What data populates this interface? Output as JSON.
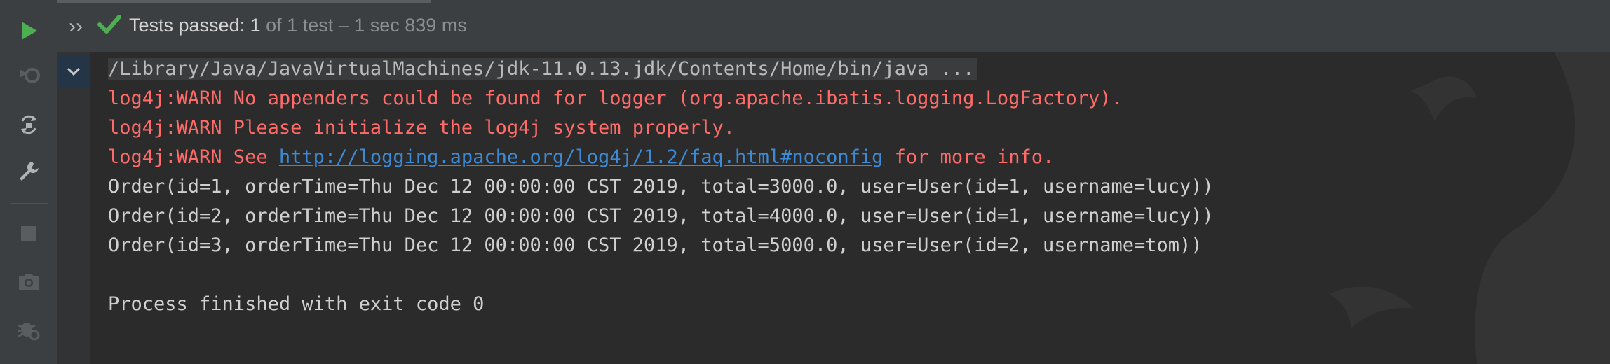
{
  "status": {
    "label": "Tests passed:",
    "count": "1",
    "detail": "of 1 test – 1 sec 839 ms"
  },
  "console": {
    "command": "/Library/Java/JavaVirtualMachines/jdk-11.0.13.jdk/Contents/Home/bin/java ...",
    "warn1": "log4j:WARN No appenders could be found for logger (org.apache.ibatis.logging.LogFactory).",
    "warn2": "log4j:WARN Please initialize the log4j system properly.",
    "warn3_prefix": "log4j:WARN See ",
    "warn3_link": "http://logging.apache.org/log4j/1.2/faq.html#noconfig",
    "warn3_suffix": " for more info.",
    "orders": [
      "Order(id=1, orderTime=Thu Dec 12 00:00:00 CST 2019, total=3000.0, user=User(id=1, username=lucy))",
      "Order(id=2, orderTime=Thu Dec 12 00:00:00 CST 2019, total=4000.0, user=User(id=1, username=lucy))",
      "Order(id=3, orderTime=Thu Dec 12 00:00:00 CST 2019, total=5000.0, user=User(id=2, username=tom))"
    ],
    "exit": "Process finished with exit code 0"
  },
  "icons": {
    "run": "run-icon",
    "rerun_failed": "rerun-failed-icon",
    "toggle_auto_test": "toggle-auto-test-icon",
    "settings": "wrench-icon",
    "stop": "stop-icon",
    "screenshot": "camera-icon",
    "debug_settings": "debug-gear-icon",
    "expand": "double-chevron-right-icon",
    "passed": "check-icon",
    "fold": "chevron-down-icon"
  },
  "colors": {
    "background": "#2b2b2b",
    "panel": "#3c3f41",
    "run_green": "#4caf50",
    "warn_red": "#ff6b68",
    "link_blue": "#3d8bd6"
  }
}
